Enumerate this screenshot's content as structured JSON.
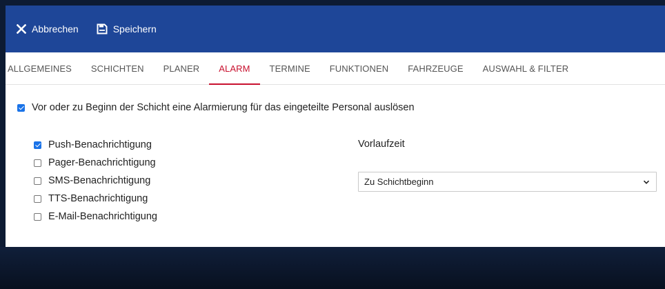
{
  "toolbar": {
    "cancel_label": "Abbrechen",
    "save_label": "Speichern",
    "background_color": "#1e4698",
    "cancel_icon": "close-icon",
    "save_icon": "floppy-disk-icon"
  },
  "tabs": [
    {
      "label": "ALLGEMEINES",
      "active": false
    },
    {
      "label": "SCHICHTEN",
      "active": false
    },
    {
      "label": "PLANER",
      "active": false
    },
    {
      "label": "ALARM",
      "active": true
    },
    {
      "label": "TERMINE",
      "active": false
    },
    {
      "label": "FUNKTIONEN",
      "active": false
    },
    {
      "label": "FAHRZEUGE",
      "active": false
    },
    {
      "label": "AUSWAHL & FILTER",
      "active": false
    }
  ],
  "accent_color": "#c8102e",
  "alarm": {
    "main_checkbox": {
      "label": "Vor oder zu Beginn der Schicht eine Alarmierung für das eingeteilte Personal auslösen",
      "checked": true
    },
    "notifications": [
      {
        "label": "Push-Benachrichtigung",
        "checked": true
      },
      {
        "label": "Pager-Benachrichtigung",
        "checked": false
      },
      {
        "label": "SMS-Benachrichtigung",
        "checked": false
      },
      {
        "label": "TTS-Benachrichtigung",
        "checked": false
      },
      {
        "label": "E-Mail-Benachrichtigung",
        "checked": false
      }
    ],
    "lead_time": {
      "label": "Vorlaufzeit",
      "selected": "Zu Schichtbeginn"
    }
  }
}
